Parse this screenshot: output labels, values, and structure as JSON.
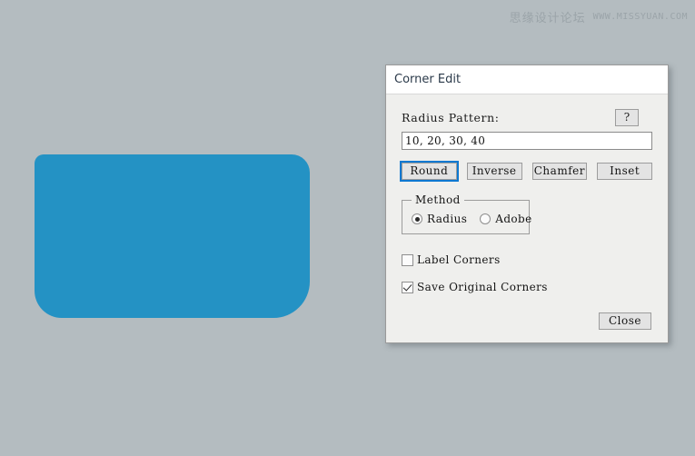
{
  "canvas": {
    "background_color": "#b4bcc0",
    "shape": {
      "name": "rounded-rectangle",
      "fill_color": "#2492c4",
      "corner_radii": {
        "top_left": "10",
        "top_right": "20",
        "bottom_right": "40",
        "bottom_left": "30"
      }
    }
  },
  "watermark": {
    "cn": "思缘设计论坛",
    "en": "WWW.MISSYUAN.COM"
  },
  "dialog": {
    "title": "Corner Edit",
    "radius_pattern": {
      "label": "Radius Pattern:",
      "help_label": "?",
      "value": "10, 20, 30, 40",
      "placeholder": ""
    },
    "buttons": [
      {
        "label": "Round",
        "focused": true
      },
      {
        "label": "Inverse",
        "focused": false
      },
      {
        "label": "Chamfer",
        "focused": false
      },
      {
        "label": "Inset",
        "focused": false
      }
    ],
    "method": {
      "title": "Method",
      "options": [
        {
          "label": "Radius",
          "selected": true
        },
        {
          "label": "Adobe",
          "selected": false
        }
      ]
    },
    "checkboxes": [
      {
        "label": "Label Corners",
        "checked": false
      },
      {
        "label": "Save Original Corners",
        "checked": true
      }
    ],
    "close_label": "Close",
    "accent_color": "#0d78d1"
  }
}
